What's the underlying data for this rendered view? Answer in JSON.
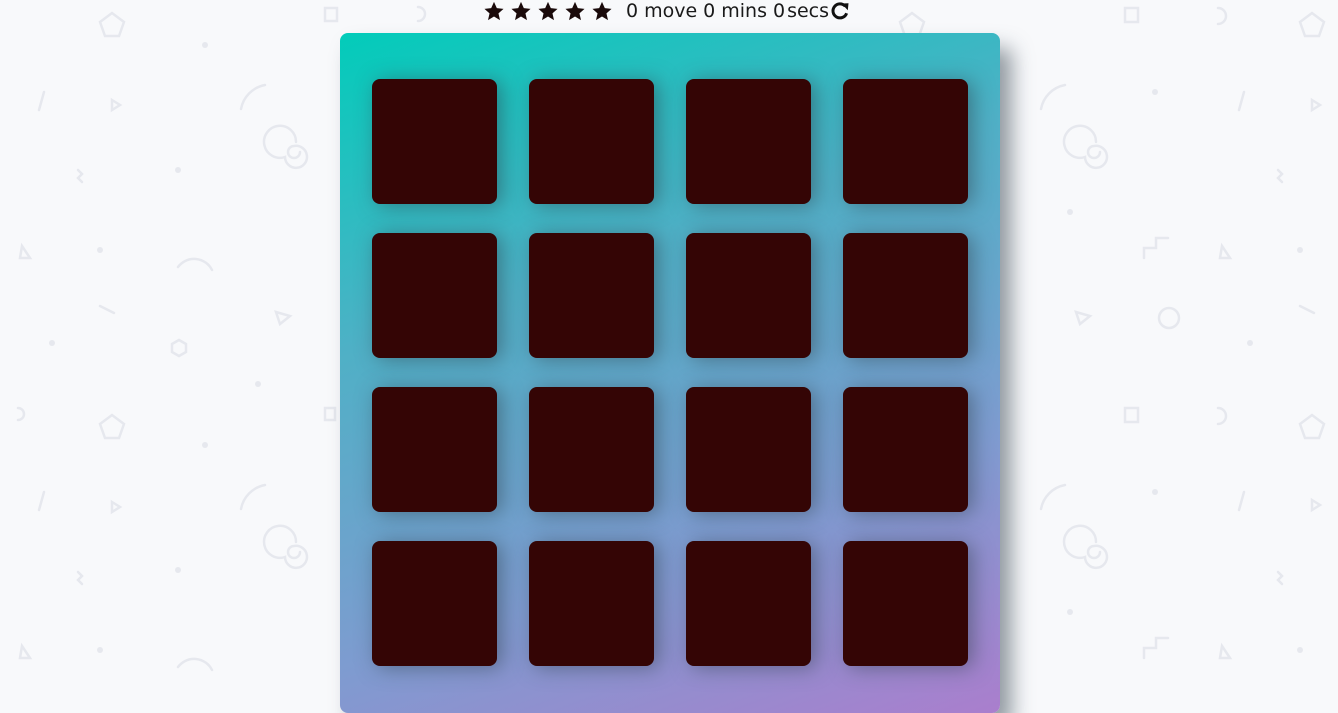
{
  "score_panel": {
    "stars": [
      "star-icon",
      "star-icon",
      "star-icon",
      "star-icon",
      "star-icon"
    ],
    "moves": "0",
    "moves_label": "move",
    "mins": "0",
    "mins_label": "mins",
    "secs": "0",
    "secs_label": "secs",
    "restart_icon": "redo-icon"
  },
  "deck": {
    "rows": 4,
    "columns": 4,
    "cards": [
      "hidden",
      "hidden",
      "hidden",
      "hidden",
      "hidden",
      "hidden",
      "hidden",
      "hidden",
      "hidden",
      "hidden",
      "hidden",
      "hidden",
      "hidden",
      "hidden",
      "hidden",
      "hidden"
    ],
    "card_color": "#340505",
    "gradient": [
      "#02ccba",
      "#aa7ecd"
    ]
  }
}
